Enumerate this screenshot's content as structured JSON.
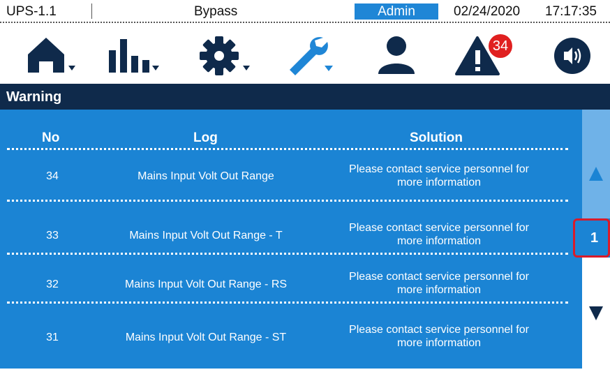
{
  "status_bar": {
    "unit": "UPS-1.1",
    "mode": "Bypass",
    "user": "Admin",
    "date": "02/24/2020",
    "time": "17:17:35",
    "user_bg_color": "#1f86d6"
  },
  "toolbar": {
    "items": [
      {
        "icon": "home-icon",
        "has_dropdown": true
      },
      {
        "icon": "bar-chart-icon",
        "has_dropdown": true
      },
      {
        "icon": "gear-icon",
        "has_dropdown": true
      },
      {
        "icon": "wrench-icon",
        "has_dropdown": true,
        "active": true
      },
      {
        "icon": "user-icon",
        "has_dropdown": false
      },
      {
        "icon": "alarm-warning-icon",
        "has_dropdown": false
      },
      {
        "icon": "sound-icon",
        "has_dropdown": false
      }
    ],
    "alarm_count": "34",
    "icon_color": "#0f2a4b",
    "active_color": "#1f86d6",
    "badge_color": "#e02020"
  },
  "section": {
    "title": "Warning",
    "bg_color": "#0f2a4b"
  },
  "table": {
    "headers": {
      "no": "No",
      "log": "Log",
      "solution": "Solution"
    },
    "rows": [
      {
        "no": "34",
        "log": "Mains Input Volt Out Range",
        "solution_line1": "Please contact service personnel for",
        "solution_line2": "more information"
      },
      {
        "no": "33",
        "log": "Mains Input Volt Out Range - T",
        "solution_line1": "Please contact service personnel for",
        "solution_line2": "more information"
      },
      {
        "no": "32",
        "log": "Mains Input Volt Out Range - RS",
        "solution_line1": "Please contact service personnel for",
        "solution_line2": "more information"
      },
      {
        "no": "31",
        "log": "Mains Input Volt Out Range - ST",
        "solution_line1": "Please contact service personnel for",
        "solution_line2": "more information"
      }
    ],
    "bg_color": "#1b84d4"
  },
  "pager": {
    "current_page": "1",
    "up_icon": "triangle-up-icon",
    "down_icon": "triangle-down-icon",
    "highlight_color": "#d81b2a"
  }
}
